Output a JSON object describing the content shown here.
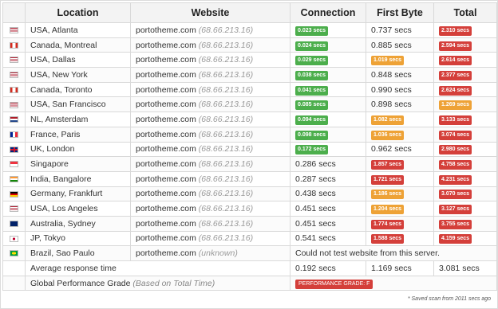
{
  "headers": {
    "location": "Location",
    "website": "Website",
    "connection": "Connection",
    "first_byte": "First Byte",
    "total": "Total"
  },
  "rows": [
    {
      "flag": "us",
      "location": "USA, Atlanta",
      "site": "portotheme.com",
      "ip": "(68.66.213.16)",
      "conn": "0.023 secs",
      "conn_color": "green",
      "fb": "0.737 secs",
      "fb_color": "",
      "total": "2.310 secs",
      "total_color": "red"
    },
    {
      "flag": "ca",
      "location": "Canada, Montreal",
      "site": "portotheme.com",
      "ip": "(68.66.213.16)",
      "conn": "0.024 secs",
      "conn_color": "green",
      "fb": "0.885 secs",
      "fb_color": "",
      "total": "2.594 secs",
      "total_color": "red"
    },
    {
      "flag": "us",
      "location": "USA, Dallas",
      "site": "portotheme.com",
      "ip": "(68.66.213.16)",
      "conn": "0.029 secs",
      "conn_color": "green",
      "fb": "1.019 secs",
      "fb_color": "orange",
      "total": "2.614 secs",
      "total_color": "red"
    },
    {
      "flag": "us",
      "location": "USA, New York",
      "site": "portotheme.com",
      "ip": "(68.66.213.16)",
      "conn": "0.038 secs",
      "conn_color": "green",
      "fb": "0.848 secs",
      "fb_color": "",
      "total": "2.377 secs",
      "total_color": "red"
    },
    {
      "flag": "ca",
      "location": "Canada, Toronto",
      "site": "portotheme.com",
      "ip": "(68.66.213.16)",
      "conn": "0.041 secs",
      "conn_color": "green",
      "fb": "0.990 secs",
      "fb_color": "",
      "total": "2.624 secs",
      "total_color": "red"
    },
    {
      "flag": "us",
      "location": "USA, San Francisco",
      "site": "portotheme.com",
      "ip": "(68.66.213.16)",
      "conn": "0.085 secs",
      "conn_color": "green",
      "fb": "0.898 secs",
      "fb_color": "",
      "total": "1.269 secs",
      "total_color": "orange"
    },
    {
      "flag": "nl",
      "location": "NL, Amsterdam",
      "site": "portotheme.com",
      "ip": "(68.66.213.16)",
      "conn": "0.094 secs",
      "conn_color": "green",
      "fb": "1.082 secs",
      "fb_color": "orange",
      "total": "3.133 secs",
      "total_color": "red"
    },
    {
      "flag": "fr",
      "location": "France, Paris",
      "site": "portotheme.com",
      "ip": "(68.66.213.16)",
      "conn": "0.098 secs",
      "conn_color": "green",
      "fb": "1.036 secs",
      "fb_color": "orange",
      "total": "3.074 secs",
      "total_color": "red"
    },
    {
      "flag": "gb",
      "location": "UK, London",
      "site": "portotheme.com",
      "ip": "(68.66.213.16)",
      "conn": "0.172 secs",
      "conn_color": "green",
      "fb": "0.962 secs",
      "fb_color": "",
      "total": "2.980 secs",
      "total_color": "red"
    },
    {
      "flag": "sg",
      "location": "Singapore",
      "site": "portotheme.com",
      "ip": "(68.66.213.16)",
      "conn": "0.286 secs",
      "conn_color": "",
      "fb": "1.857 secs",
      "fb_color": "red",
      "total": "4.758 secs",
      "total_color": "red"
    },
    {
      "flag": "in",
      "location": "India, Bangalore",
      "site": "portotheme.com",
      "ip": "(68.66.213.16)",
      "conn": "0.287 secs",
      "conn_color": "",
      "fb": "1.721 secs",
      "fb_color": "red",
      "total": "4.231 secs",
      "total_color": "red"
    },
    {
      "flag": "de",
      "location": "Germany, Frankfurt",
      "site": "portotheme.com",
      "ip": "(68.66.213.16)",
      "conn": "0.438 secs",
      "conn_color": "",
      "fb": "1.186 secs",
      "fb_color": "orange",
      "total": "3.070 secs",
      "total_color": "red"
    },
    {
      "flag": "us",
      "location": "USA, Los Angeles",
      "site": "portotheme.com",
      "ip": "(68.66.213.16)",
      "conn": "0.451 secs",
      "conn_color": "",
      "fb": "1.204 secs",
      "fb_color": "orange",
      "total": "3.127 secs",
      "total_color": "red"
    },
    {
      "flag": "au",
      "location": "Australia, Sydney",
      "site": "portotheme.com",
      "ip": "(68.66.213.16)",
      "conn": "0.451 secs",
      "conn_color": "",
      "fb": "1.774 secs",
      "fb_color": "red",
      "total": "3.755 secs",
      "total_color": "red"
    },
    {
      "flag": "jp",
      "location": "JP, Tokyo",
      "site": "portotheme.com",
      "ip": "(68.66.213.16)",
      "conn": "0.541 secs",
      "conn_color": "",
      "fb": "1.588 secs",
      "fb_color": "red",
      "total": "4.159 secs",
      "total_color": "red"
    }
  ],
  "brazil": {
    "flag": "br",
    "location": "Brazil, Sao Paulo",
    "site": "portotheme.com",
    "ip": "(unknown)",
    "message": "Could not test website from this server."
  },
  "average": {
    "label": "Average response time",
    "conn": "0.192 secs",
    "fb": "1.169 secs",
    "total": "3.081 secs"
  },
  "grade": {
    "label": "Global Performance Grade",
    "sub": "(Based on Total Time)",
    "badge": "PERFORMANCE GRADE: F"
  },
  "footnote": "* Saved scan from 2011 secs ago",
  "colors": {
    "green": "#4cae4c",
    "orange": "#eea236",
    "red": "#d43f3a"
  }
}
